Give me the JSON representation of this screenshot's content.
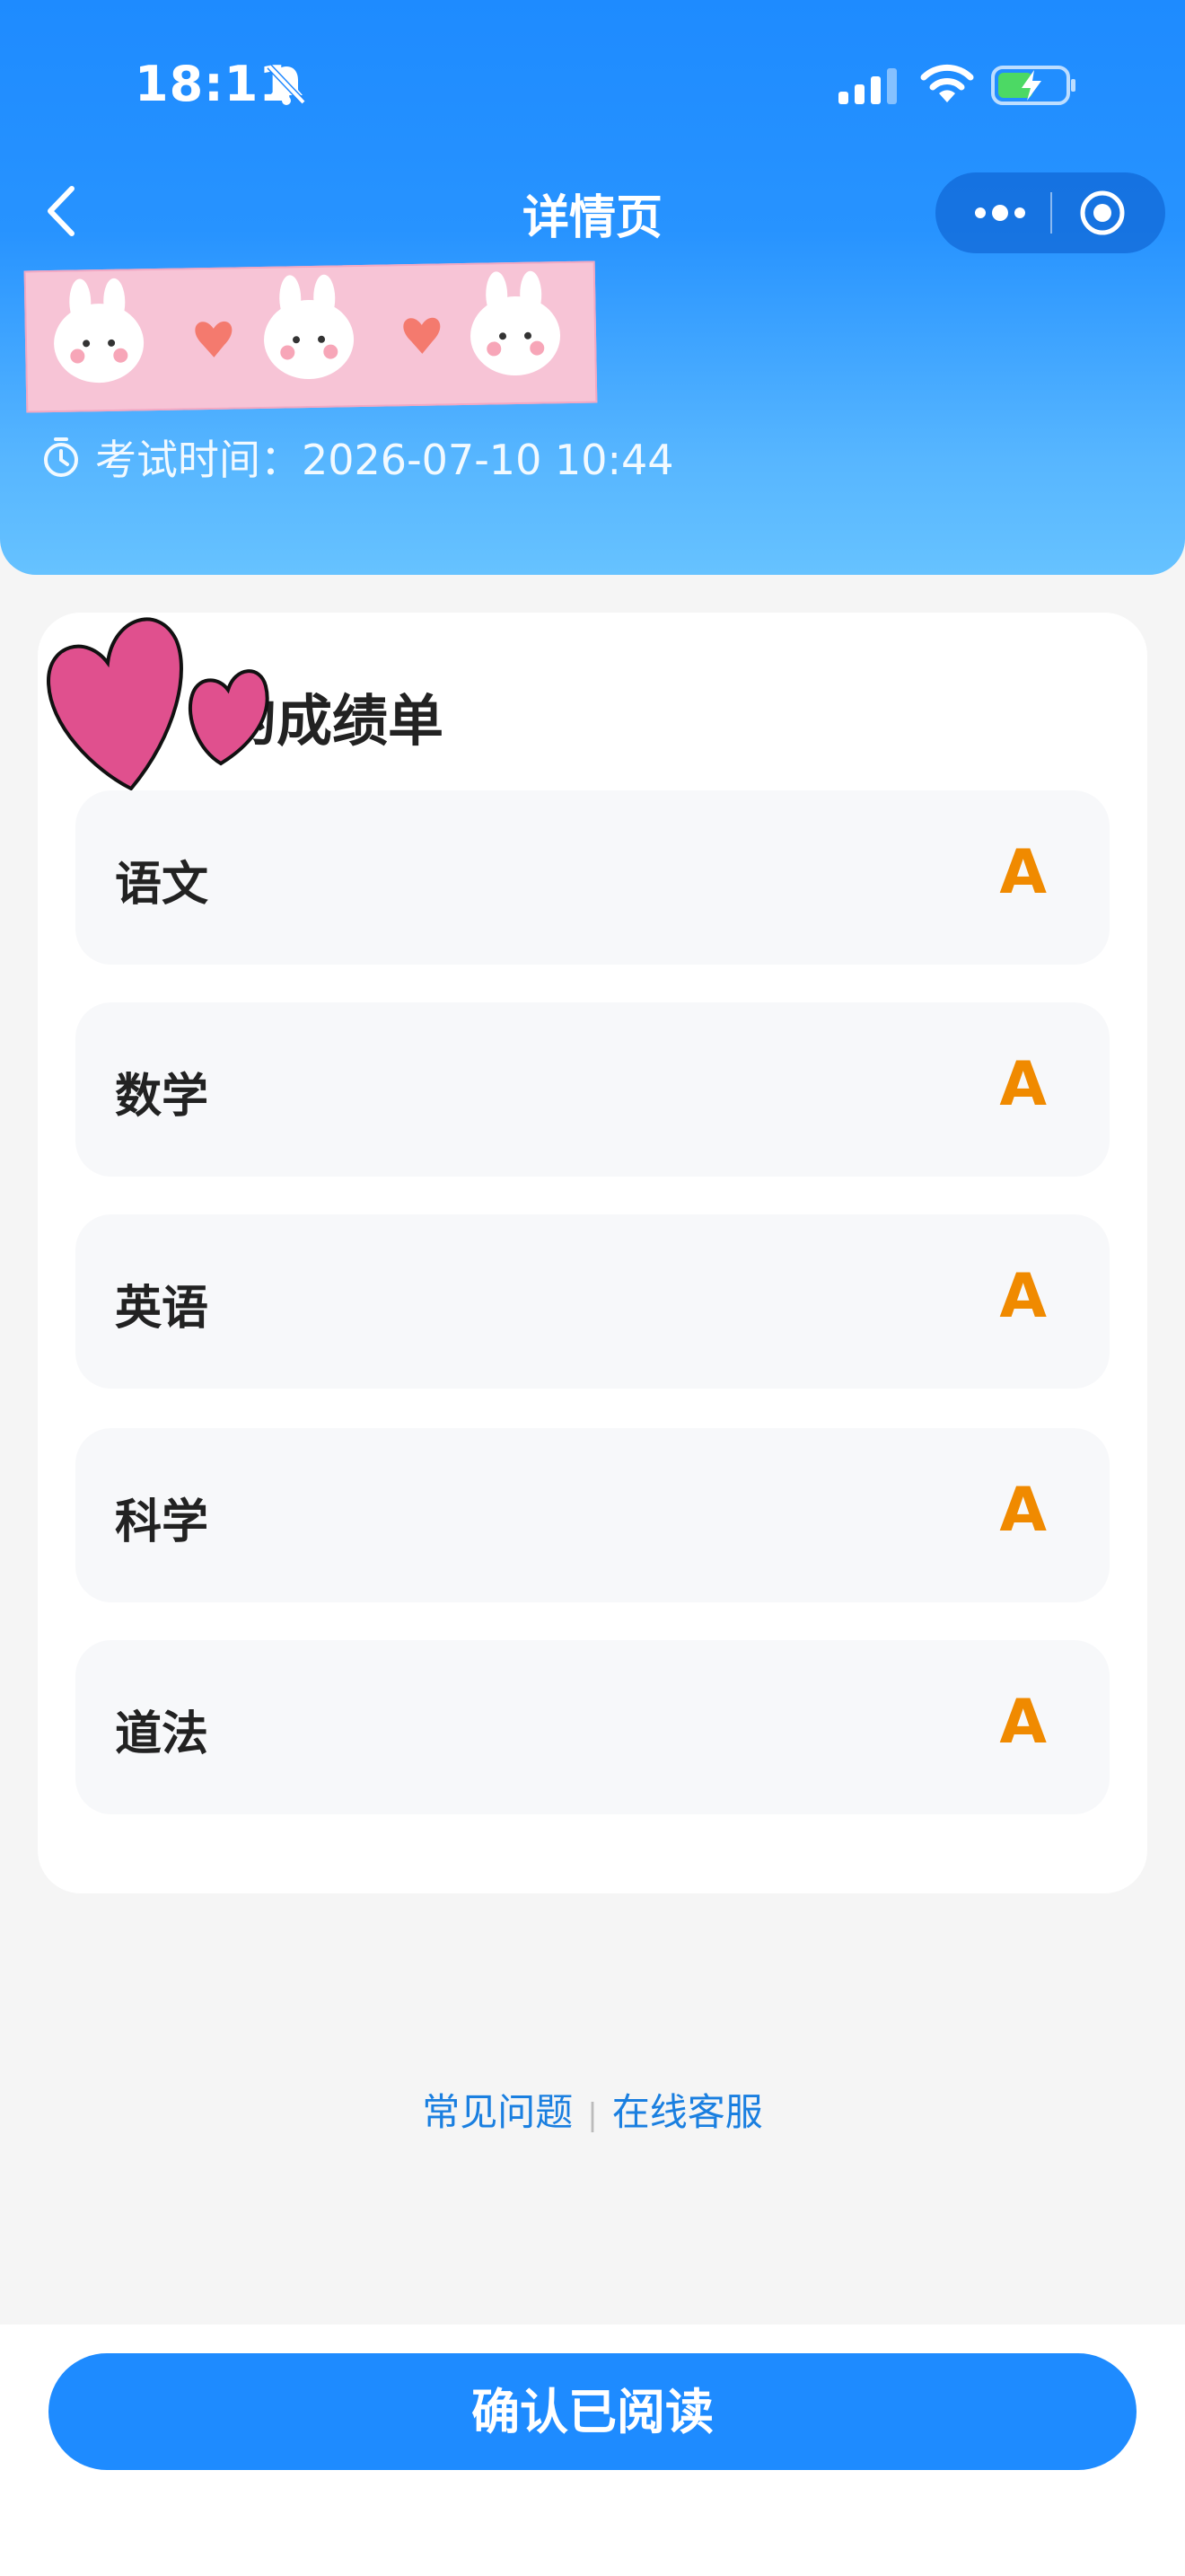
{
  "status_bar": {
    "time": "18:11",
    "icons": [
      "bell-slash-icon",
      "signal-icon",
      "wifi-icon",
      "battery-charging-icon"
    ]
  },
  "nav": {
    "title": "详情页",
    "back_icon": "chevron-left-icon",
    "more_icon": "more-dots-icon",
    "target_icon": "target-icon"
  },
  "header": {
    "exam_time": "考试时间：2026-07-10 10:44",
    "clock_icon": "stopwatch-icon"
  },
  "card": {
    "title": "的成绩单",
    "rows": [
      {
        "subject": "语文",
        "grade": "A"
      },
      {
        "subject": "数学",
        "grade": "A"
      },
      {
        "subject": "英语",
        "grade": "A"
      },
      {
        "subject": "科学",
        "grade": "A"
      },
      {
        "subject": "道法",
        "grade": "A"
      }
    ]
  },
  "links": {
    "faq": "常见问题",
    "service": "在线客服"
  },
  "footer": {
    "confirm_label": "确认已阅读"
  },
  "colors": {
    "primary": "#1e8bff",
    "grade": "#f08a00",
    "link": "#1a7fe0"
  }
}
